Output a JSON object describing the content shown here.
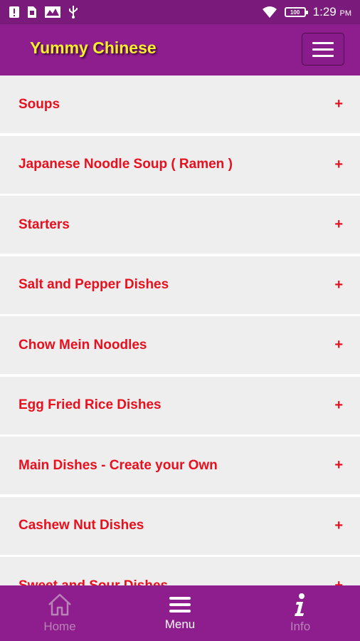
{
  "status": {
    "time": "1:29",
    "ampm": "PM",
    "battery": "100"
  },
  "header": {
    "title": "Yummy Chinese",
    "menu_icon": "hamburger-icon"
  },
  "menu": {
    "items": [
      {
        "label": "Soups",
        "toggle": "+"
      },
      {
        "label": "Japanese Noodle Soup ( Ramen )",
        "toggle": "+"
      },
      {
        "label": "Starters",
        "toggle": "+"
      },
      {
        "label": "Salt and Pepper Dishes",
        "toggle": "+"
      },
      {
        "label": "Chow Mein Noodles",
        "toggle": "+"
      },
      {
        "label": "Egg Fried Rice Dishes",
        "toggle": "+"
      },
      {
        "label": "Main Dishes - Create your Own",
        "toggle": "+"
      },
      {
        "label": "Cashew Nut Dishes",
        "toggle": "+"
      },
      {
        "label": "Sweet and Sour Dishes",
        "toggle": "+"
      }
    ]
  },
  "bottom_nav": {
    "home": "Home",
    "menu": "Menu",
    "info": "Info"
  },
  "colors": {
    "primary": "#8e1d8e",
    "title": "#f7ee2e",
    "item_text": "#e8101e",
    "item_bg": "#eeeeee"
  }
}
